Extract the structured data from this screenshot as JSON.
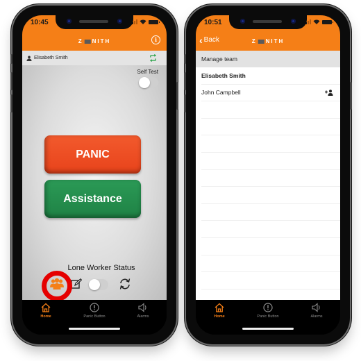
{
  "left_screen": {
    "status_bar": {
      "time": "10:45"
    },
    "header": {
      "logo_text_pre": "Z",
      "logo_text_post": "NITH",
      "info_icon": "info-icon"
    },
    "user_bar": {
      "user_name": "Elisabeth Smith",
      "user_icon": "user-icon",
      "sync_icon": "sync-icon"
    },
    "self_test": {
      "label": "Self Test",
      "enabled": false
    },
    "buttons": {
      "panic": "PANIC",
      "assistance": "Assistance"
    },
    "lone_worker": {
      "label": "Lone Worker Status",
      "enabled": false,
      "icons": [
        "team-icon",
        "edit-icon",
        "refresh-icon"
      ],
      "highlighted": "team-icon"
    },
    "colors": {
      "brand": "#f57f17",
      "panic": "#e8431b",
      "assistance": "#1f8245",
      "highlight": "#e50000"
    }
  },
  "right_screen": {
    "status_bar": {
      "time": "10:51"
    },
    "header": {
      "back_label": "Back",
      "logo_text_pre": "Z",
      "logo_text_post": "NITH"
    },
    "section_title": "Manage team",
    "team": [
      {
        "name": "Elisabeth Smith",
        "bold": true,
        "action_icon": ""
      },
      {
        "name": "John Campbell",
        "bold": false,
        "action_icon": "add-person-icon"
      }
    ],
    "empty_rows": 11
  },
  "tab_bar": {
    "tabs": [
      {
        "label": "Home",
        "icon": "home-icon",
        "active": true
      },
      {
        "label": "Panic Button",
        "icon": "exclamation-circle-icon",
        "active": false
      },
      {
        "label": "Alarms",
        "icon": "speaker-icon",
        "active": false
      }
    ]
  }
}
